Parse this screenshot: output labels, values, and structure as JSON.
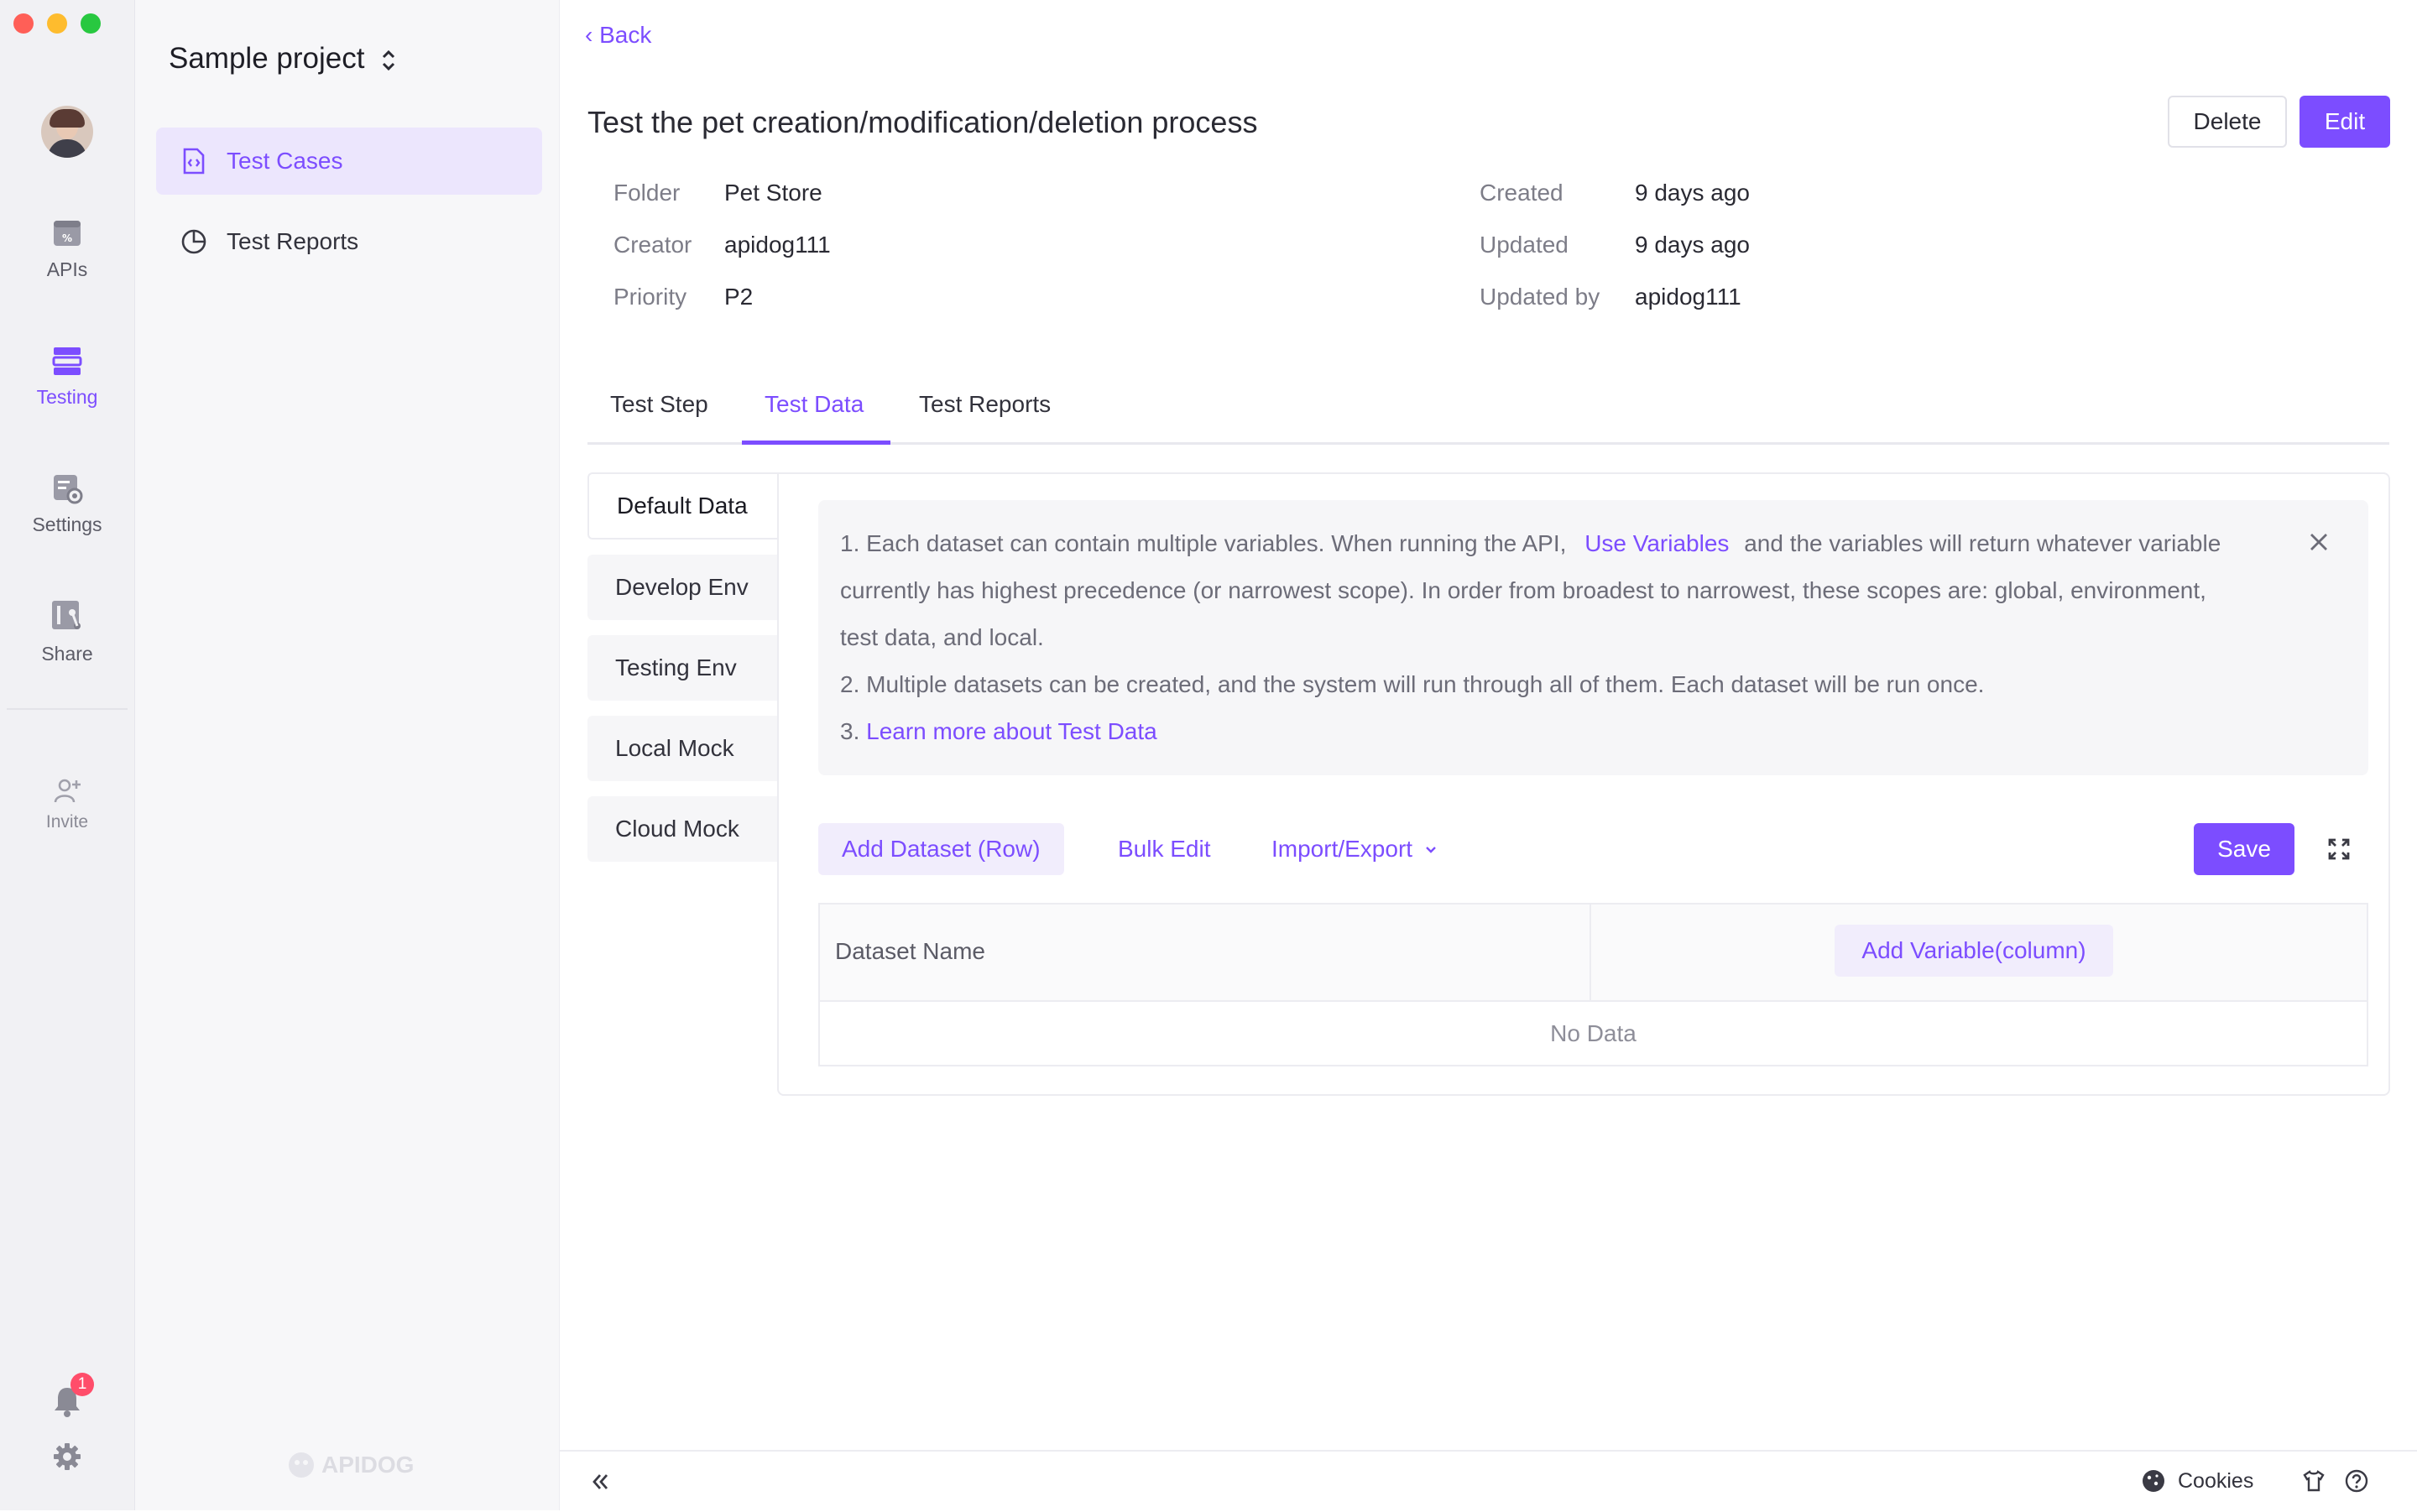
{
  "window": {
    "traffic_lights": [
      "#ff5f57",
      "#febc2e",
      "#28c840"
    ]
  },
  "rail": {
    "items": [
      {
        "label": "APIs",
        "icon": "apis-icon"
      },
      {
        "label": "Testing",
        "icon": "testing-icon",
        "active": true
      },
      {
        "label": "Settings",
        "icon": "settings-icon"
      },
      {
        "label": "Share",
        "icon": "share-icon"
      }
    ],
    "invite_label": "Invite",
    "notification_count": "1"
  },
  "sidebar": {
    "project_name": "Sample project",
    "items": [
      {
        "label": "Test Cases",
        "icon": "test-case-file-icon",
        "active": true
      },
      {
        "label": "Test Reports",
        "icon": "pie-chart-icon"
      }
    ],
    "brand_watermark": "APIDOG"
  },
  "main": {
    "back_label": "Back",
    "title": "Test the pet creation/modification/deletion process",
    "delete_label": "Delete",
    "edit_label": "Edit",
    "meta": {
      "folder_label": "Folder",
      "folder_value": "Pet Store",
      "creator_label": "Creator",
      "creator_value": "apidog111",
      "priority_label": "Priority",
      "priority_value": "P2",
      "created_label": "Created",
      "created_value": "9 days ago",
      "updated_label": "Updated",
      "updated_value": "9 days ago",
      "updated_by_label": "Updated by",
      "updated_by_value": "apidog111"
    },
    "tabs": [
      {
        "label": "Test Step"
      },
      {
        "label": "Test Data",
        "active": true
      },
      {
        "label": "Test Reports"
      }
    ],
    "environments": [
      {
        "label": "Default Data",
        "active": true
      },
      {
        "label": "Develop Env"
      },
      {
        "label": "Testing Env"
      },
      {
        "label": "Local Mock"
      },
      {
        "label": "Cloud Mock"
      }
    ],
    "info": {
      "line1_pre": "1. Each dataset can contain multiple variables. When running the API,",
      "line1_link": "Use Variables",
      "line1_post": "and the variables will return whatever variable",
      "line2": "currently has highest precedence (or narrowest scope). In order from broadest to narrowest, these scopes are: global, environment,",
      "line3": "test data, and local.",
      "line4": "2. Multiple datasets can be created, and the system will run through all of them. Each dataset will be run once.",
      "line5_pre": "3.",
      "line5_link": "Learn more about Test Data"
    },
    "actions": {
      "add_dataset": "Add Dataset (Row)",
      "bulk_edit": "Bulk Edit",
      "import_export": "Import/Export",
      "save": "Save"
    },
    "table": {
      "col_dataset_name": "Dataset Name",
      "add_variable": "Add Variable(column)",
      "empty_text": "No Data"
    }
  },
  "bottombar": {
    "cookies_label": "Cookies"
  },
  "colors": {
    "accent": "#7c4dff",
    "accent_light": "#ece6fd",
    "notify": "#ff4d6a"
  }
}
